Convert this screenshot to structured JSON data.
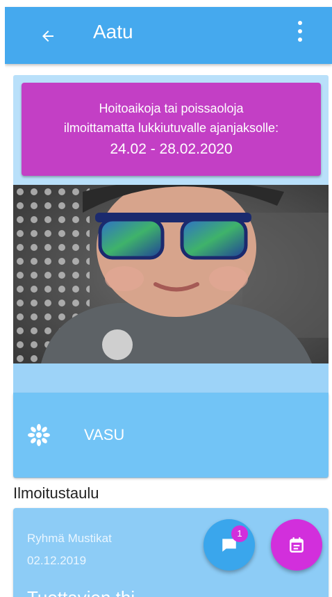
{
  "header": {
    "title": "Aatu",
    "back_icon": "arrow-left-icon",
    "menu_icon": "more-vertical-icon"
  },
  "notice": {
    "line1": "Hoitoaikoja tai poissaoloja",
    "line2": "ilmoittamatta lukkiutuvalle ajanjaksolle:",
    "line3": "24.02 - 28.02.2020",
    "color": "#c33fc5"
  },
  "vasu": {
    "label": "VASU",
    "icon": "flower-icon"
  },
  "board": {
    "title": "Ilmoitustaulu",
    "post": {
      "group": "Ryhmä Mustikat",
      "date": "02.12.2019",
      "title": "Tuottavien thi"
    }
  },
  "fabs": {
    "chat": {
      "icon": "chat-icon",
      "badge": "1",
      "color": "#3aa6ec"
    },
    "calendar": {
      "icon": "calendar-icon",
      "color": "#d22fdc"
    }
  },
  "colors": {
    "accent": "#45a9ee",
    "card": "#72c4f6"
  }
}
